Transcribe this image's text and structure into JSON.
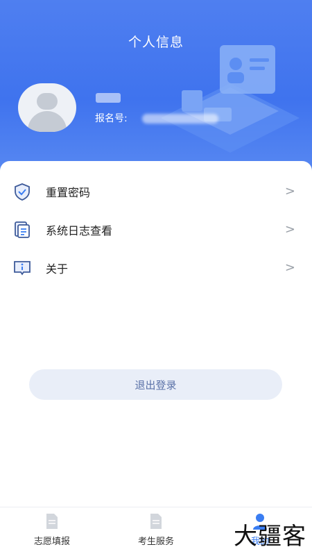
{
  "header": {
    "title": "个人信息",
    "user_name": "",
    "registration_label": "报名号:",
    "registration_value": ""
  },
  "menu": {
    "items": [
      {
        "label": "重置密码",
        "icon": "shield-check-icon"
      },
      {
        "label": "系统日志查看",
        "icon": "document-list-icon"
      },
      {
        "label": "关于",
        "icon": "info-icon"
      }
    ],
    "arrow": ">"
  },
  "logout": {
    "label": "退出登录"
  },
  "tabbar": {
    "tabs": [
      {
        "label": "志愿填报",
        "icon": "document-icon"
      },
      {
        "label": "考生服务",
        "icon": "document-icon"
      },
      {
        "label": "我的",
        "icon": "user-icon",
        "active": true
      }
    ]
  },
  "watermark": "大疆客",
  "colors": {
    "header_blue": "#3f73ee",
    "active_blue": "#3a7df2",
    "logout_text": "#5b72a8"
  }
}
